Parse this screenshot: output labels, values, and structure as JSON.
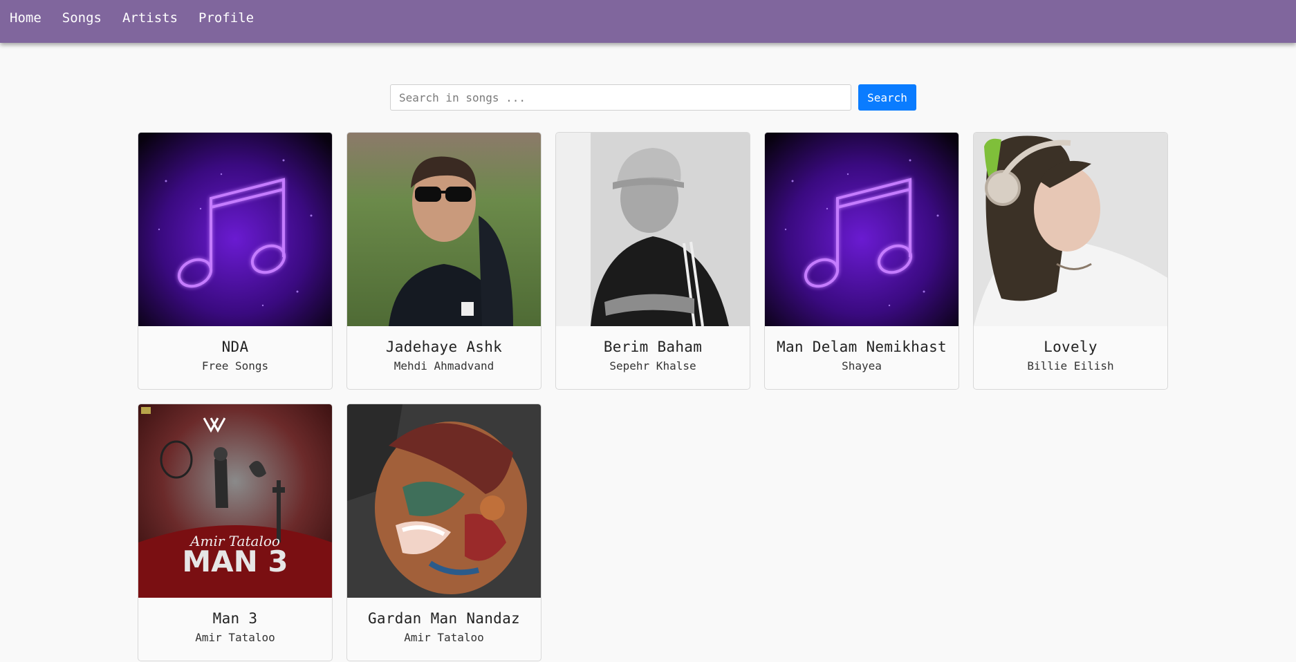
{
  "nav": {
    "items": [
      {
        "label": "Home"
      },
      {
        "label": "Songs"
      },
      {
        "label": "Artists"
      },
      {
        "label": "Profile"
      }
    ]
  },
  "search": {
    "placeholder": "Search in songs ...",
    "value": "",
    "button_label": "Search"
  },
  "songs": [
    {
      "title": "NDA",
      "artist": "Free Songs",
      "image": "neon-music-note-icon"
    },
    {
      "title": "Jadehaye Ashk",
      "artist": "Mehdi Ahmadvand",
      "image": "artist-photo"
    },
    {
      "title": "Berim Baham",
      "artist": "Sepehr Khalse",
      "image": "artist-photo-bw"
    },
    {
      "title": "Man Delam Nemikhast",
      "artist": "Shayea",
      "image": "neon-music-note-icon"
    },
    {
      "title": "Lovely",
      "artist": "Billie Eilish",
      "image": "artist-photo"
    },
    {
      "title": "Man 3",
      "artist": "Amir Tataloo",
      "image": "album-cover",
      "cover_text": "MAN 3",
      "cover_script": "Amir Tataloo"
    },
    {
      "title": "Gardan Man Nandaz",
      "artist": "Amir Tataloo",
      "image": "album-cover"
    }
  ],
  "colors": {
    "navbar": "#80669d",
    "search_button": "#0a7cff",
    "background": "#f9f9f9"
  }
}
